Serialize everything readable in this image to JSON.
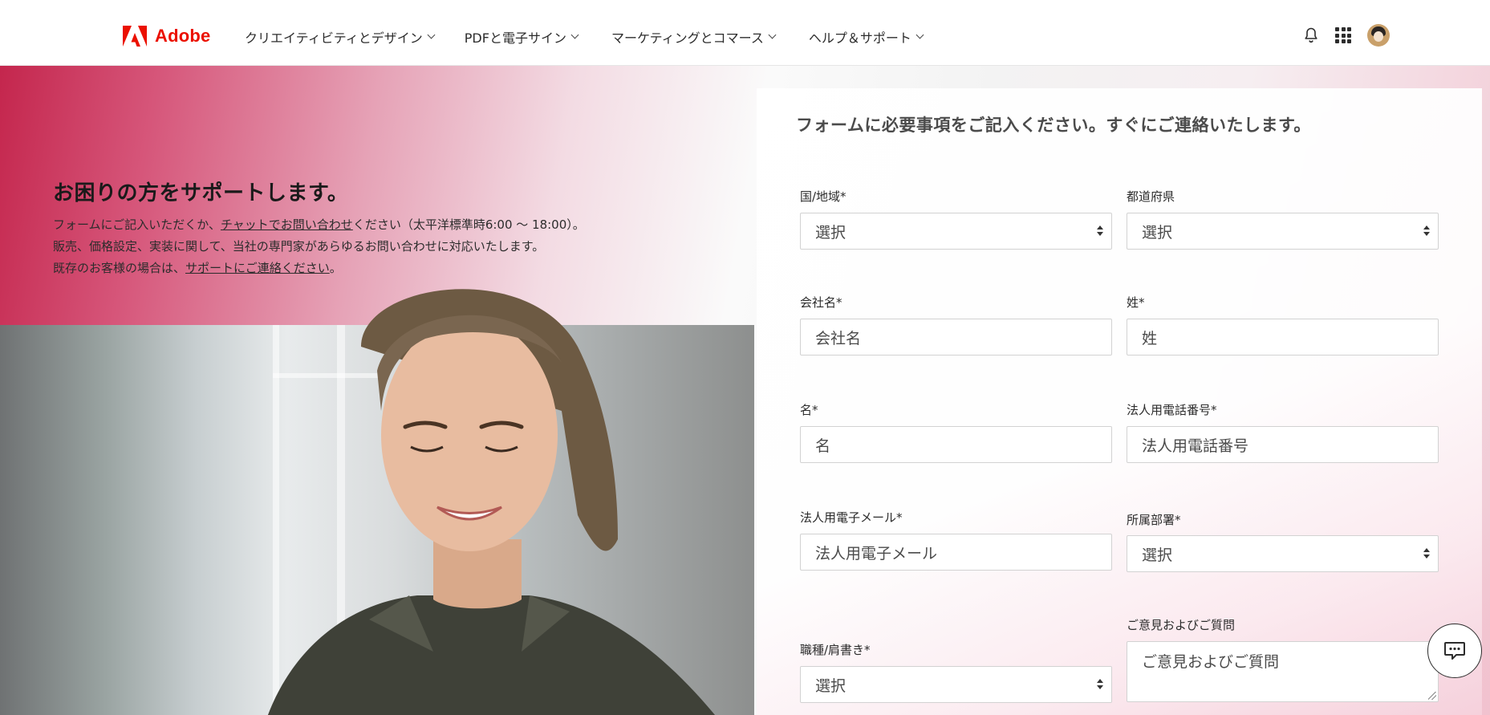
{
  "brand": {
    "name": "Adobe",
    "color": "#eb1000"
  },
  "nav": {
    "items": [
      {
        "label": "クリエイティビティとデザイン"
      },
      {
        "label": "PDFと電子サイン"
      },
      {
        "label": "マーケティングとコマース"
      },
      {
        "label": "ヘルプ＆サポート"
      }
    ],
    "icons": [
      "bell-icon",
      "app-grid-icon",
      "avatar"
    ]
  },
  "hero": {
    "title": "お困りの方をサポートします。",
    "line1_pre": "フォームにご記入いただくか、",
    "line1_link": "チャットでお問い合わせ",
    "line1_post": "ください（太平洋標準時6:00 〜 18:00）。",
    "line2": "販売、価格設定、実装に関して、当社の専門家があらゆるお問い合わせに対応いたします。",
    "line3_pre": "既存のお客様の場合は、",
    "line3_link": "サポートにご連絡ください",
    "line3_post": "。"
  },
  "form": {
    "title": "フォームに必要事項をご記入ください。すぐにご連絡いたします。",
    "country": {
      "label": "国/地域*",
      "value": "選択"
    },
    "prefecture": {
      "label": "都道府県",
      "value": "選択"
    },
    "company": {
      "label": "会社名*",
      "placeholder": "会社名"
    },
    "last_name": {
      "label": "姓*",
      "placeholder": "姓"
    },
    "first_name": {
      "label": "名*",
      "placeholder": "名"
    },
    "phone": {
      "label": "法人用電話番号*",
      "placeholder": "法人用電話番号"
    },
    "email": {
      "label": "法人用電子メール*",
      "placeholder": "法人用電子メール"
    },
    "department": {
      "label": "所属部署*",
      "value": "選択"
    },
    "job_title": {
      "label": "職種/肩書き*",
      "value": "選択"
    },
    "comments": {
      "label": "ご意見およびご質問",
      "placeholder": "ご意見およびご質問"
    }
  },
  "chat": {
    "icon": "chat-icon"
  }
}
